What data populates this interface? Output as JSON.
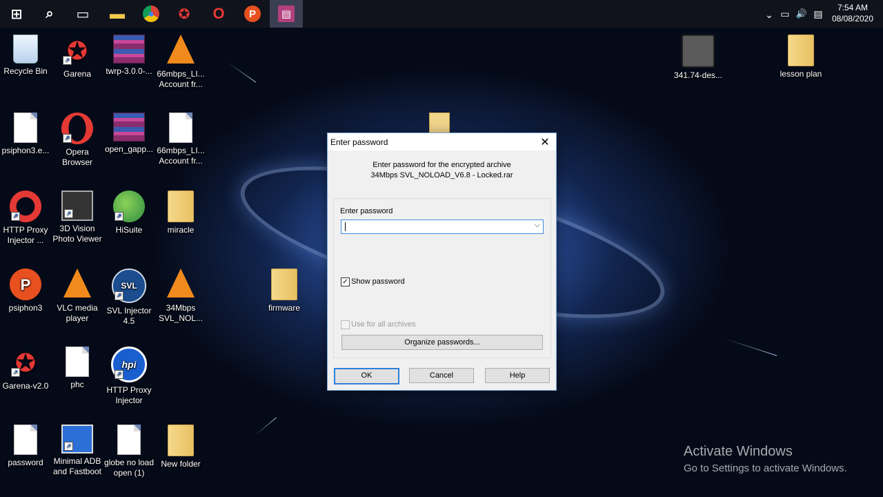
{
  "taskbar": {
    "items": [
      {
        "name": "start-button",
        "glyph": "⊞",
        "color": "#ffffff"
      },
      {
        "name": "search-button",
        "glyph": "⌕",
        "color": "#ffffff"
      },
      {
        "name": "task-view-button",
        "glyph": "▭",
        "color": "#ffffff"
      },
      {
        "name": "file-explorer-button",
        "glyph": "▬",
        "color": "#f2c94c"
      },
      {
        "name": "chrome-button",
        "glyph": "●",
        "color": "#e9b32a"
      },
      {
        "name": "garena-button",
        "glyph": "✪",
        "color": "#e53935"
      },
      {
        "name": "opera-button",
        "glyph": "O",
        "color": "#e53935"
      },
      {
        "name": "psiphon-button",
        "glyph": "P",
        "color": "#e8501f"
      },
      {
        "name": "winrar-button",
        "glyph": "▤",
        "color": "#b2407f"
      }
    ],
    "tray": {
      "chevron": "⌃",
      "network": "▭",
      "volume": "🔊",
      "notifications": "▤"
    },
    "time": "7:54 AM",
    "date": "08/08/2020"
  },
  "desktop": {
    "icons": [
      {
        "label": "Recycle Bin"
      },
      {
        "label": "Garena"
      },
      {
        "label": "twrp-3.0.0-..."
      },
      {
        "label": "66mbps_LI... Account fr..."
      },
      {
        "label": "psiphon3.e..."
      },
      {
        "label": "Opera Browser"
      },
      {
        "label": "open_gapp..."
      },
      {
        "label": "66mbps_LI... Account fr..."
      },
      {
        "label": "HTTP Proxy Injector ..."
      },
      {
        "label": "3D Vision Photo Viewer"
      },
      {
        "label": "HiSuite"
      },
      {
        "label": "miracle"
      },
      {
        "label": "psiphon3"
      },
      {
        "label": "VLC media player"
      },
      {
        "label": "SVL Injector 4.5"
      },
      {
        "label": "34Mbps SVL_NOL..."
      },
      {
        "label": "firmware"
      },
      {
        "label": "Garena-v2.0"
      },
      {
        "label": "phc"
      },
      {
        "label": "HTTP Proxy Injector"
      },
      {
        "label": "password"
      },
      {
        "label": "Minimal ADB and Fastboot"
      },
      {
        "label": "globe no load open (1)"
      },
      {
        "label": "New folder"
      },
      {
        "label": "341.74-des..."
      },
      {
        "label": "lesson plan"
      }
    ],
    "hpi_badge": "hpi",
    "svl_badge": "SVL"
  },
  "watermark": {
    "line1": "Activate Windows",
    "line2": "Go to Settings to activate Windows."
  },
  "dialog": {
    "title": "Enter password",
    "close_glyph": "✕",
    "message_line1": "Enter password for the encrypted archive",
    "message_line2": "34Mbps SVL_NOLOAD_V6.8 - Locked.rar",
    "password_label": "Enter password",
    "password_value": "",
    "dropdown_glyph": "⌵",
    "show_password_label": "Show password",
    "show_password_checked": true,
    "check_glyph": "✓",
    "use_all_label": "Use for all archives",
    "use_all_checked": false,
    "organize_label": "Organize passwords...",
    "ok_label": "OK",
    "cancel_label": "Cancel",
    "help_label": "Help"
  }
}
